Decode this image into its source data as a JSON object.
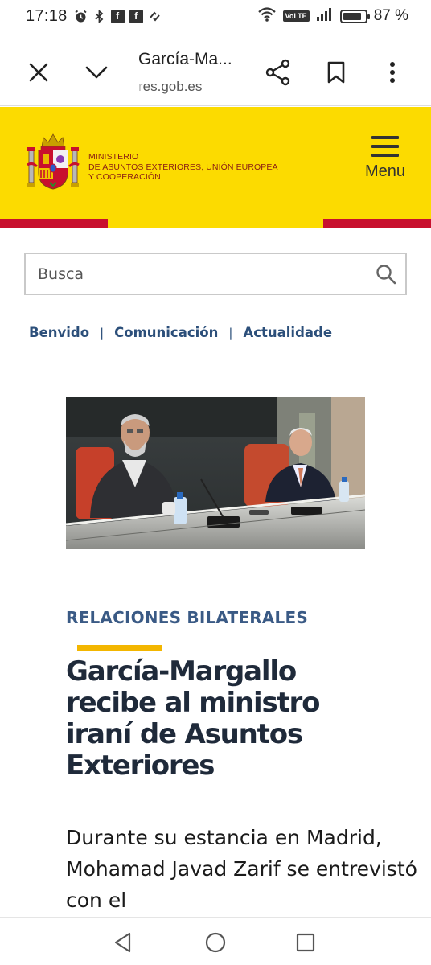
{
  "status_bar": {
    "time": "17:18",
    "battery_percent": "87 %",
    "battery_level": 0.87,
    "network_badge": "VoLTE",
    "left_icons": [
      "alarm-icon",
      "bluetooth-icon",
      "facebook-icon",
      "facebook-icon",
      "sync-icon"
    ]
  },
  "browser": {
    "title": "García-Ma...",
    "url_faded": "r",
    "url": "es.gob.es"
  },
  "site": {
    "ministry_line1": "MINISTERIO",
    "ministry_line2": "DE ASUNTOS EXTERIORES, UNIÓN EUROPEA",
    "ministry_line3": "Y COOPERACIÓN",
    "menu_label": "Menu"
  },
  "search": {
    "placeholder": "Busca"
  },
  "breadcrumb": {
    "items": [
      "Benvido",
      "Comunicación",
      "Actualidade"
    ],
    "separator": "|"
  },
  "article": {
    "category": "RELACIONES BILATERALES",
    "headline": "García-Margallo recibe al ministro iraní de Asuntos Exteriores",
    "lead": "Durante su estancia en Madrid, Mohamad Javad Zarif se entrevistó con el"
  },
  "colors": {
    "header_yellow": "#fcdb00",
    "flag_red": "#c8102e",
    "accent_gold": "#f3b600",
    "link_blue": "#2c4f7a"
  }
}
